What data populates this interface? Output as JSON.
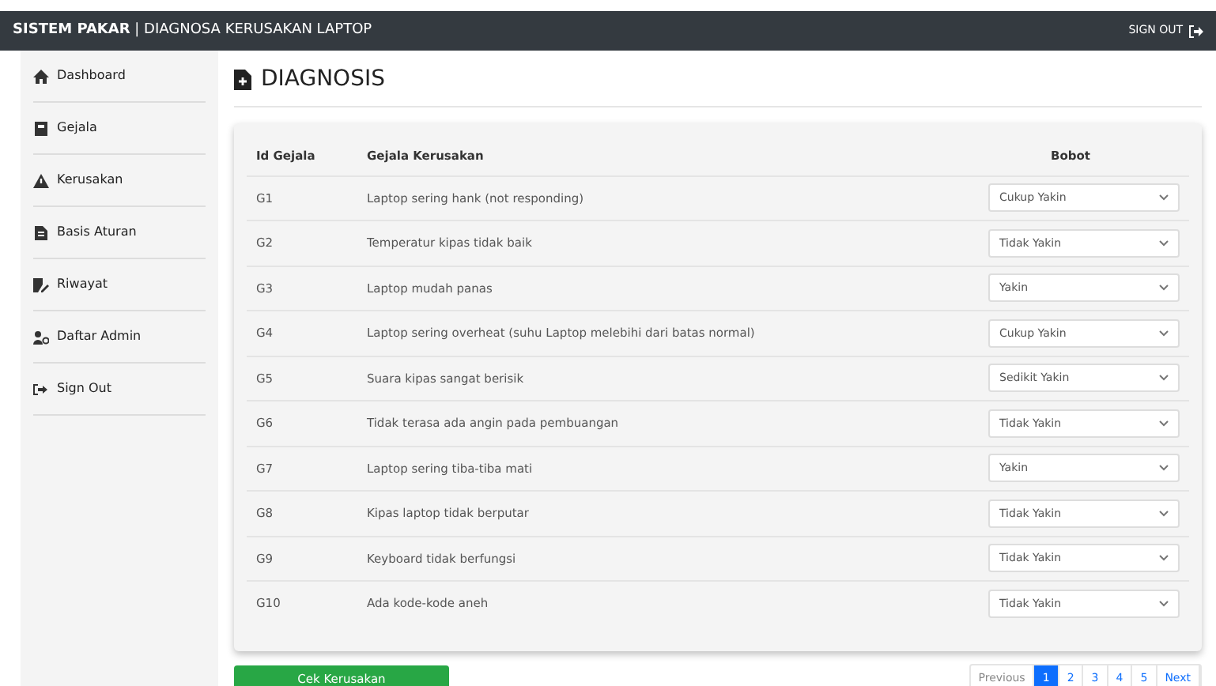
{
  "navbar": {
    "brand_bold": "SISTEM PAKAR",
    "brand_rest": "| DIAGNOSA KERUSAKAN LAPTOP",
    "signout": "SIGN OUT"
  },
  "sidebar": {
    "items": [
      {
        "label": "Dashboard"
      },
      {
        "label": "Gejala"
      },
      {
        "label": "Kerusakan"
      },
      {
        "label": "Basis Aturan"
      },
      {
        "label": "Riwayat"
      },
      {
        "label": "Daftar Admin"
      },
      {
        "label": "Sign Out"
      }
    ]
  },
  "page_title": "DIAGNOSIS",
  "table": {
    "columns": [
      "Id Gejala",
      "Gejala Kerusakan",
      "Bobot"
    ],
    "rows": [
      {
        "id": "G1",
        "gejala": "Laptop sering hank (not responding)",
        "bobot": "Cukup Yakin"
      },
      {
        "id": "G2",
        "gejala": "Temperatur kipas tidak baik",
        "bobot": "Tidak Yakin"
      },
      {
        "id": "G3",
        "gejala": "Laptop mudah panas",
        "bobot": "Yakin"
      },
      {
        "id": "G4",
        "gejala": "Laptop sering overheat (suhu Laptop melebihi dari batas normal)",
        "bobot": "Cukup Yakin"
      },
      {
        "id": "G5",
        "gejala": "Suara kipas sangat berisik",
        "bobot": "Sedikit Yakin"
      },
      {
        "id": "G6",
        "gejala": "Tidak terasa ada angin pada pembuangan",
        "bobot": "Tidak Yakin"
      },
      {
        "id": "G7",
        "gejala": "Laptop sering tiba-tiba mati",
        "bobot": "Yakin"
      },
      {
        "id": "G8",
        "gejala": "Kipas laptop tidak berputar",
        "bobot": "Tidak Yakin"
      },
      {
        "id": "G9",
        "gejala": "Keyboard tidak berfungsi",
        "bobot": "Tidak Yakin"
      },
      {
        "id": "G10",
        "gejala": "Ada kode-kode aneh",
        "bobot": "Tidak Yakin"
      }
    ]
  },
  "submit_button": "Cek Kerusakan",
  "pagination": [
    {
      "label": "Previous",
      "selected": false,
      "disabled": true
    },
    {
      "label": "1",
      "selected": true,
      "disabled": false
    },
    {
      "label": "2",
      "selected": false,
      "disabled": false
    },
    {
      "label": "3",
      "selected": false,
      "disabled": false
    },
    {
      "label": "4",
      "selected": false,
      "disabled": false
    },
    {
      "label": "5",
      "selected": false,
      "disabled": false
    },
    {
      "label": "Next",
      "selected": false,
      "disabled": false
    }
  ]
}
